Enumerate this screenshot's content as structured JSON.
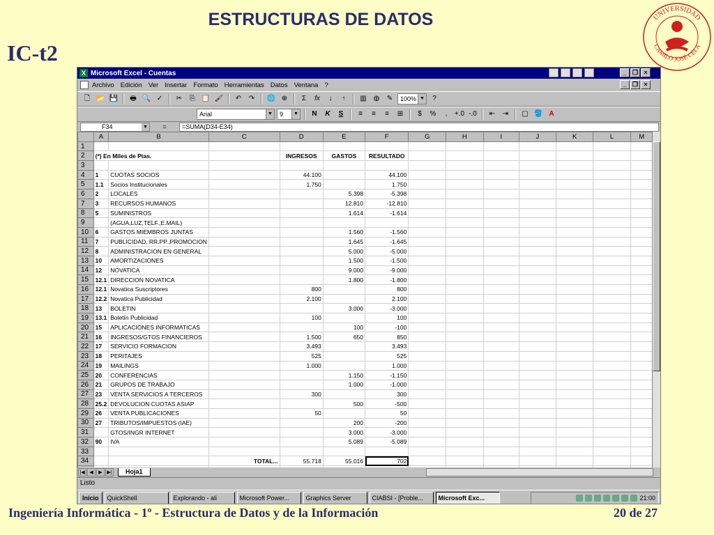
{
  "slide": {
    "title": "ESTRUCTURAS DE DATOS",
    "code": "IC-t2",
    "footer_left": "Ingeniería Informática - 1º - Estructura de Datos y de la Información",
    "footer_right": "20 de 27",
    "logo_text": "UNIVERSIDAD CAMILO JOSÉ CELA"
  },
  "window": {
    "title": "Microsoft Excel - Cuentas",
    "menu": [
      "Archivo",
      "Edición",
      "Ver",
      "Insertar",
      "Formato",
      "Herramientas",
      "Datos",
      "Ventana",
      "?"
    ],
    "zoom": "100%",
    "font": "Arial",
    "font_size": "9",
    "name_box": "F34",
    "formula_eq": "=",
    "formula": "=SUMA(D34-E34)"
  },
  "sheet": {
    "columns": [
      "A",
      "B",
      "C",
      "D",
      "E",
      "F",
      "G",
      "H",
      "I",
      "J",
      "K",
      "L",
      "M"
    ],
    "rows": [
      {
        "n": "1",
        "a": "",
        "b": "",
        "d": "",
        "e": "",
        "f": ""
      },
      {
        "n": "2",
        "a": "(*) En Miles de Ptas.",
        "b": "",
        "d": "INGRESOS",
        "e": "GASTOS",
        "f": "RESULTADO"
      },
      {
        "n": "3",
        "a": "",
        "b": "",
        "d": "",
        "e": "",
        "f": ""
      },
      {
        "n": "4",
        "a": "1",
        "b": "CUOTAS SOCIOS",
        "d": "44.100",
        "e": "",
        "f": "44.100"
      },
      {
        "n": "5",
        "a": "1.1",
        "b": "Socios Institucionales",
        "d": "1.750",
        "e": "",
        "f": "1.750"
      },
      {
        "n": "6",
        "a": "2",
        "b": "LOCALES",
        "d": "",
        "e": "5.398",
        "f": "-5.398"
      },
      {
        "n": "7",
        "a": "3",
        "b": "RECURSOS HUMANOS",
        "d": "",
        "e": "12.810",
        "f": "-12.810"
      },
      {
        "n": "8",
        "a": "5",
        "b": "SUMINISTROS",
        "d": "",
        "e": "1.614",
        "f": "-1.614"
      },
      {
        "n": "9",
        "a": "",
        "b": "(AGUA,LUZ,TELF.,E.MAIL)",
        "d": "",
        "e": "",
        "f": ""
      },
      {
        "n": "10",
        "a": "6",
        "b": "GASTOS MIEMBROS JUNTAS",
        "d": "",
        "e": "1.560",
        "f": "-1.560"
      },
      {
        "n": "11",
        "a": "7",
        "b": "PUBLICIDAD, RR.PP.,PROMOCION",
        "d": "",
        "e": "1.645",
        "f": "-1.645"
      },
      {
        "n": "12",
        "a": "8",
        "b": "ADMINISTRACION EN GENERAL",
        "d": "",
        "e": "5.000",
        "f": "-5.000"
      },
      {
        "n": "13",
        "a": "10",
        "b": "AMORTIZACIONES",
        "d": "",
        "e": "1.500",
        "f": "-1.500"
      },
      {
        "n": "14",
        "a": "12",
        "b": "NOVATICA",
        "d": "",
        "e": "9.000",
        "f": "-9.000"
      },
      {
        "n": "15",
        "a": "12.1",
        "b": "DIRECCION NOVATICA",
        "d": "",
        "e": "1.800",
        "f": "-1.800"
      },
      {
        "n": "16",
        "a": "12.1",
        "b": "Novatica Suscriptores",
        "d": "800",
        "e": "",
        "f": "800"
      },
      {
        "n": "17",
        "a": "12.2",
        "b": "Novatica Publicidad",
        "d": "2.100",
        "e": "",
        "f": "2.100"
      },
      {
        "n": "18",
        "a": "13",
        "b": "BOLETIN",
        "d": "",
        "e": "3.000",
        "f": "-3.000"
      },
      {
        "n": "19",
        "a": "13.1",
        "b": "Boletín Publicidad",
        "d": "100",
        "e": "",
        "f": "100"
      },
      {
        "n": "20",
        "a": "15",
        "b": "APLICACIONES INFORMATICAS",
        "d": "",
        "e": "100",
        "f": "-100"
      },
      {
        "n": "21",
        "a": "16",
        "b": "INGRESOS/GTOS FINANCIEROS",
        "d": "1.500",
        "e": "650",
        "f": "850"
      },
      {
        "n": "22",
        "a": "17",
        "b": "SERVICIO FORMACION",
        "d": "3.493",
        "e": "",
        "f": "3.493"
      },
      {
        "n": "23",
        "a": "18",
        "b": "PERITAJES",
        "d": "525",
        "e": "",
        "f": "525"
      },
      {
        "n": "24",
        "a": "19",
        "b": "MAILINGS",
        "d": "1.000",
        "e": "",
        "f": "1.000"
      },
      {
        "n": "25",
        "a": "20",
        "b": "CONFERENCIAS",
        "d": "",
        "e": "1.150",
        "f": "-1.150"
      },
      {
        "n": "26",
        "a": "21",
        "b": "GRUPOS DE TRABAJO",
        "d": "",
        "e": "1.000",
        "f": "-1.000"
      },
      {
        "n": "27",
        "a": "23",
        "b": "VENTA SERVICIOS A TERCEROS",
        "d": "300",
        "e": "",
        "f": "300"
      },
      {
        "n": "28",
        "a": "25.2",
        "b": "DEVOLUCION CUOTAS ASIAP",
        "d": "",
        "e": "500",
        "f": "-500"
      },
      {
        "n": "29",
        "a": "26",
        "b": "VENTA PUBLICACIONES",
        "d": "50",
        "e": "",
        "f": "50"
      },
      {
        "n": "30",
        "a": "27",
        "b": "TRIBUTOS/IMPUESTOS (IAE)",
        "d": "",
        "e": "200",
        "f": "-200"
      },
      {
        "n": "31",
        "a": "",
        "b": "GTOS/INGR INTERNET",
        "d": "",
        "e": "3.000",
        "f": "-3.000"
      },
      {
        "n": "32",
        "a": "90",
        "b": "IVA",
        "d": "",
        "e": "5.089",
        "f": "-5.089"
      },
      {
        "n": "33",
        "a": "",
        "b": "",
        "d": "",
        "e": "",
        "f": ""
      },
      {
        "n": "34",
        "a": "",
        "b": "",
        "d": "55.718",
        "e": "55.016",
        "f": "702"
      },
      {
        "n": "35",
        "a": "",
        "b": "",
        "d": "",
        "e": "",
        "f": ""
      }
    ],
    "total_label": "TOTAL...",
    "tab_name": "Hoja1"
  },
  "status": "Listo",
  "taskbar": {
    "start": "Inicio",
    "items": [
      "QuickShell",
      "Explorando - ali",
      "Microsoft Power...",
      "Graphics Server",
      "CIABSI - [Proble...",
      "Microsoft Exc..."
    ],
    "clock": "21:00"
  }
}
